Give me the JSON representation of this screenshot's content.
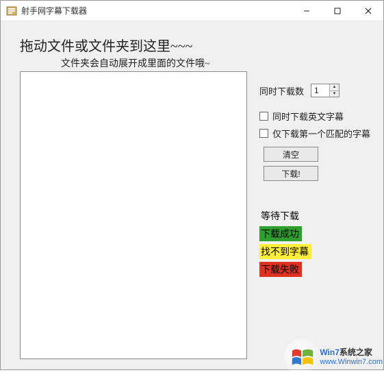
{
  "window": {
    "title": "射手网字幕下载器"
  },
  "main": {
    "heading": "拖动文件或文件夹到这里~~~",
    "subheading": "文件夹会自动展开成里面的文件哦~"
  },
  "controls": {
    "concurrent_label": "同时下载数",
    "concurrent_value": "1",
    "checkbox_english": "同时下载英文字幕",
    "checkbox_firstmatch": "仅下载第一个匹配的字幕",
    "clear_button": "清空",
    "download_button": "下载!"
  },
  "legend": {
    "waiting": "等待下载",
    "success": "下载成功",
    "notfound": "找不到字幕",
    "failed": "下载失败"
  },
  "watermark": {
    "line1_prefix": "Win7",
    "line1_suffix": "系统之家",
    "line2": "www.Winwin7.com"
  }
}
